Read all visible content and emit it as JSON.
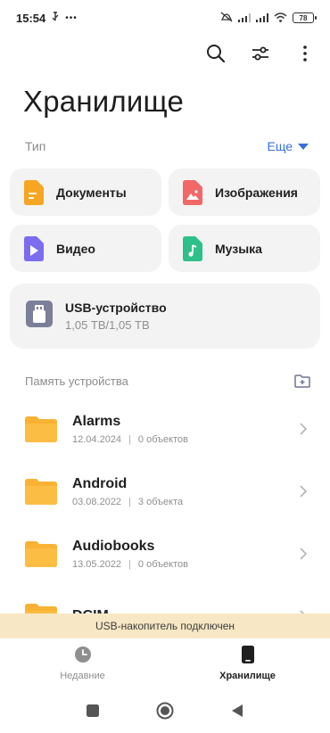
{
  "status_bar": {
    "time": "15:54",
    "extra": "•••",
    "battery": "78"
  },
  "page_title": "Хранилище",
  "type_section": {
    "label": "Тип",
    "more_label": "Еще"
  },
  "categories": [
    {
      "label": "Документы",
      "color": "#f5a623"
    },
    {
      "label": "Изображения",
      "color": "#f16868"
    },
    {
      "label": "Видео",
      "color": "#7b6cf0"
    },
    {
      "label": "Музыка",
      "color": "#2fc08a"
    }
  ],
  "usb_device": {
    "name": "USB-устройство",
    "size": "1,05 ТВ/1,05 ТВ"
  },
  "memory_section": {
    "label": "Память устройства"
  },
  "folders": [
    {
      "name": "Alarms",
      "date": "12.04.2024",
      "sep": "|",
      "count": "0 объектов"
    },
    {
      "name": "Android",
      "date": "03.08.2022",
      "sep": "|",
      "count": "3 объекта"
    },
    {
      "name": "Audiobooks",
      "date": "13.05.2022",
      "sep": "|",
      "count": "0 объектов"
    },
    {
      "name": "DCIM",
      "date": "",
      "sep": "",
      "count": ""
    }
  ],
  "banner": {
    "text": "USB-накопитель подключен"
  },
  "bottom_nav": {
    "recent_label": "Недавние",
    "storage_label": "Хранилище"
  },
  "colors": {
    "folder": "#f9b233",
    "accent_blue": "#3a6fd8",
    "banner_bg": "#f8e7c5",
    "card_bg": "#f3f3f3"
  }
}
